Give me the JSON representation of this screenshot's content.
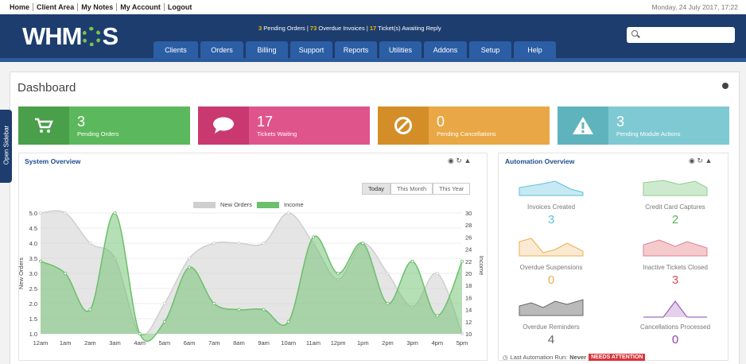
{
  "topbar": {
    "links": [
      "Home",
      "Client Area",
      "My Notes",
      "My Account",
      "Logout"
    ],
    "date": "Monday, 24 July 2017, 17:22"
  },
  "header": {
    "logo": "WHMCS",
    "alerts": {
      "pending_count": "3",
      "pending_text": "Pending Orders",
      "overdue_count": "73",
      "overdue_text": "Overdue Invoices",
      "tickets_count": "17",
      "tickets_text": "Ticket(s) Awaiting Reply"
    },
    "search_placeholder": "",
    "nav": [
      "Clients",
      "Orders",
      "Billing",
      "Support",
      "Reports",
      "Utilities",
      "Addons",
      "Setup",
      "Help"
    ]
  },
  "sidebar_tab": "Open Sidebar",
  "dashboard": {
    "title": "Dashboard",
    "stats": [
      {
        "value": "3",
        "label": "Pending Orders",
        "color": "#5cb85c",
        "icon_color": "#4a9f4a",
        "icon": "cart-icon"
      },
      {
        "value": "17",
        "label": "Tickets Waiting",
        "color": "#e0548c",
        "icon_color": "#c9396f",
        "icon": "chat-icon"
      },
      {
        "value": "0",
        "label": "Pending Cancellations",
        "color": "#e9a745",
        "icon_color": "#d48e28",
        "icon": "ban-icon"
      },
      {
        "value": "3",
        "label": "Pending Module Actions",
        "color": "#7fc9d2",
        "icon_color": "#5fb3bd",
        "icon": "warning-icon"
      }
    ]
  },
  "system_overview": {
    "title": "System Overview",
    "toggles": [
      "Today",
      "This Month",
      "This Year"
    ],
    "active_toggle": "Today"
  },
  "chart_data": {
    "type": "area",
    "title": "",
    "xlabel": "",
    "ylabel": "New Orders",
    "y2label": "Income",
    "x": [
      "12am",
      "1am",
      "2am",
      "3am",
      "4am",
      "5am",
      "6am",
      "7am",
      "8am",
      "9am",
      "10am",
      "11am",
      "12pm",
      "1pm",
      "2pm",
      "3pm",
      "4pm",
      "5pm"
    ],
    "ylim": [
      1.0,
      5.0
    ],
    "y_ticks": [
      "1.0",
      "1.5",
      "2.0",
      "2.5",
      "3.0",
      "3.5",
      "4.0",
      "4.5",
      "5.0"
    ],
    "y2lim": [
      10,
      30
    ],
    "y2_ticks": [
      "10",
      "12",
      "14",
      "16",
      "18",
      "20",
      "22",
      "24",
      "26",
      "28",
      "30"
    ],
    "legend_position": "top-center",
    "series": [
      {
        "name": "New Orders",
        "axis": "left",
        "color": "#cfcfcf",
        "values": [
          5.0,
          5.0,
          4.0,
          3.5,
          1.0,
          2.0,
          3.5,
          4.0,
          4.0,
          4.0,
          5.0,
          4.0,
          2.8,
          4.0,
          3.0,
          1.9,
          3.0,
          1.0
        ]
      },
      {
        "name": "Income",
        "axis": "right",
        "color": "#6cbf6c",
        "values": [
          22,
          20,
          14,
          30,
          10,
          12,
          21,
          15,
          14,
          14,
          12,
          26,
          20,
          25,
          15,
          22,
          13,
          22
        ]
      }
    ]
  },
  "automation": {
    "title": "Automation Overview",
    "items": [
      {
        "label": "Invoices Created",
        "value": "3",
        "color": "#5bc0de"
      },
      {
        "label": "Credit Card Captures",
        "value": "2",
        "color": "#5cb85c"
      },
      {
        "label": "Overdue Suspensions",
        "value": "0",
        "color": "#f0ad4e"
      },
      {
        "label": "Inactive Tickets Closed",
        "value": "3",
        "color": "#d9534f"
      },
      {
        "label": "Overdue Reminders",
        "value": "4",
        "color": "#666666"
      },
      {
        "label": "Cancellations Processed",
        "value": "0",
        "color": "#8e44ad"
      }
    ],
    "footer_label": "Last Automation Run:",
    "footer_value": "Never",
    "badge": "NEEDS ATTENTION"
  }
}
